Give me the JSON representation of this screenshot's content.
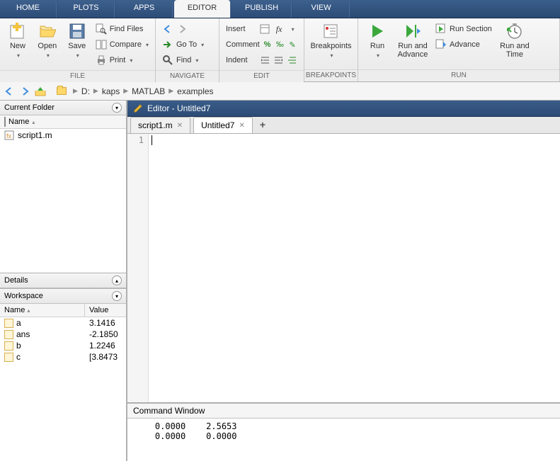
{
  "tabs": {
    "home": "HOME",
    "plots": "PLOTS",
    "apps": "APPS",
    "editor": "EDITOR",
    "publish": "PUBLISH",
    "view": "VIEW"
  },
  "ribbon": {
    "file": {
      "group": "FILE",
      "new": "New",
      "open": "Open",
      "save": "Save",
      "find_files": "Find Files",
      "compare": "Compare",
      "print": "Print"
    },
    "navigate": {
      "group": "NAVIGATE",
      "goto": "Go To",
      "find": "Find"
    },
    "edit": {
      "group": "EDIT",
      "insert": "Insert",
      "comment": "Comment",
      "indent": "Indent"
    },
    "breakpoints": {
      "group": "BREAKPOINTS",
      "label": "Breakpoints"
    },
    "run": {
      "group": "RUN",
      "run": "Run",
      "run_advance": "Run and\nAdvance",
      "run_section": "Run Section",
      "advance": "Advance",
      "run_time": "Run and\nTime"
    }
  },
  "breadcrumbs": [
    "D:",
    "kaps",
    "MATLAB",
    "examples"
  ],
  "panels": {
    "current_folder": "Current Folder",
    "details": "Details",
    "workspace": "Workspace",
    "name_col": "Name",
    "value_col": "Value"
  },
  "files": [
    {
      "name": "script1.m"
    }
  ],
  "workspace": [
    {
      "name": "a",
      "value": "3.1416"
    },
    {
      "name": "ans",
      "value": "-2.1850"
    },
    {
      "name": "b",
      "value": "1.2246"
    },
    {
      "name": "c",
      "value": "[3.8473"
    }
  ],
  "editor": {
    "title": "Editor - Untitled7",
    "tabs": [
      {
        "label": "script1.m",
        "active": false
      },
      {
        "label": "Untitled7",
        "active": true
      }
    ],
    "line_number": "1"
  },
  "command_window": {
    "title": "Command Window",
    "output": "    0.0000    2.5653\n    0.0000    0.0000"
  }
}
